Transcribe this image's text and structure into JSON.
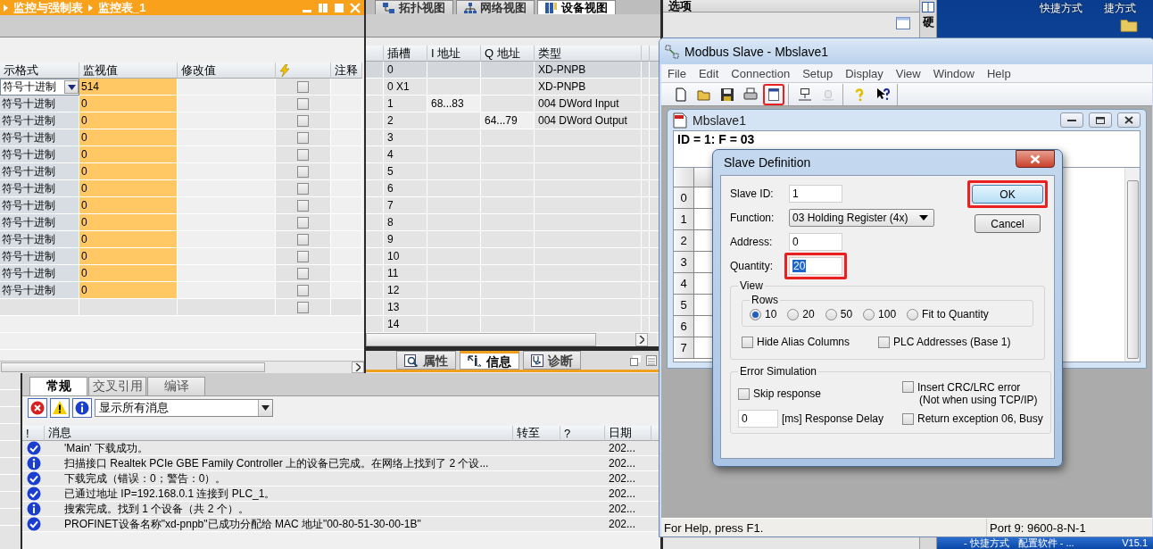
{
  "watch_table": {
    "breadcrumb": [
      "监控与强制表",
      "监控表_1"
    ],
    "columns": [
      "示格式",
      "监视值",
      "修改值",
      "注释"
    ],
    "rows": [
      {
        "format": "符号十进制",
        "value": "514",
        "editing": true,
        "checked": false
      },
      {
        "format": "符号十进制",
        "value": "0",
        "editing": false,
        "checked": false
      },
      {
        "format": "符号十进制",
        "value": "0",
        "editing": false,
        "checked": false
      },
      {
        "format": "符号十进制",
        "value": "0",
        "editing": false,
        "checked": false
      },
      {
        "format": "符号十进制",
        "value": "0",
        "editing": false,
        "checked": false
      },
      {
        "format": "符号十进制",
        "value": "0",
        "editing": false,
        "checked": false
      },
      {
        "format": "符号十进制",
        "value": "0",
        "editing": false,
        "checked": false
      },
      {
        "format": "符号十进制",
        "value": "0",
        "editing": false,
        "checked": false
      },
      {
        "format": "符号十进制",
        "value": "0",
        "editing": false,
        "checked": false
      },
      {
        "format": "符号十进制",
        "value": "0",
        "editing": false,
        "checked": false
      },
      {
        "format": "符号十进制",
        "value": "0",
        "editing": false,
        "checked": false
      },
      {
        "format": "符号十进制",
        "value": "0",
        "editing": false,
        "checked": false
      },
      {
        "format": "符号十进制",
        "value": "0",
        "editing": false,
        "checked": false
      },
      {
        "editing": false,
        "checked": false
      }
    ]
  },
  "view_tabs": [
    {
      "label": "拓扑视图",
      "selected": false
    },
    {
      "label": "网络视图",
      "selected": false
    },
    {
      "label": "设备视图",
      "selected": true
    }
  ],
  "device_table": {
    "columns": [
      "插槽",
      "I 地址",
      "Q 地址",
      "类型"
    ],
    "rows": [
      {
        "slot": "0",
        "type": "XD-PNPB",
        "selected": true
      },
      {
        "slot": "0 X1",
        "type": "XD-PNPB",
        "selected": false
      },
      {
        "slot": "1",
        "i_address": "68...83",
        "type": "004 DWord Input",
        "selected": false
      },
      {
        "slot": "2",
        "q_address": "64...79",
        "type": "004 DWord Output",
        "selected": false
      },
      {
        "slot": "3",
        "selected": false
      },
      {
        "slot": "4",
        "selected": false
      },
      {
        "slot": "5",
        "selected": false
      },
      {
        "slot": "6",
        "selected": false
      },
      {
        "slot": "7",
        "selected": false
      },
      {
        "slot": "8",
        "selected": false
      },
      {
        "slot": "9",
        "selected": false
      },
      {
        "slot": "10",
        "selected": false
      },
      {
        "slot": "11",
        "selected": false
      },
      {
        "slot": "12",
        "selected": false
      },
      {
        "slot": "13",
        "selected": false
      },
      {
        "slot": "14",
        "selected": false
      }
    ]
  },
  "inspector_tabs": [
    {
      "label": "属性",
      "selected": false
    },
    {
      "label": "信息",
      "selected": true
    },
    {
      "label": "诊断",
      "selected": false
    }
  ],
  "info_tabs": [
    {
      "label": "常规",
      "selected": true
    },
    {
      "label": "交叉引用",
      "selected": false
    },
    {
      "label": "编译",
      "selected": false
    }
  ],
  "message_filter": "显示所有消息",
  "messages": {
    "columns": [
      "!",
      "消息",
      "转至",
      "?",
      "日期"
    ],
    "rows": [
      {
        "kind": "success",
        "text": "'Main' 下载成功。",
        "date": "202..."
      },
      {
        "kind": "info",
        "text": "扫描接口 Realtek PCIe GBE Family Controller 上的设备已完成。在网络上找到了 2 个设...",
        "date": "202..."
      },
      {
        "kind": "success",
        "text": "下载完成（错误：0；警告：0）。",
        "date": "202..."
      },
      {
        "kind": "success",
        "text": "已通过地址 IP=192.168.0.1 连接到 PLC_1。",
        "date": "202..."
      },
      {
        "kind": "info",
        "text": "搜索完成。找到 1 个设备（共 2 个）。",
        "date": "202..."
      },
      {
        "kind": "success",
        "text": "PROFINET设备名称\"xd-pnpb\"已成功分配给 MAC 地址\"00-80-51-30-00-1B\"",
        "date": "202..."
      }
    ]
  },
  "options_panel": {
    "title": "选项",
    "side_tab": "硬"
  },
  "desktop": {
    "icons": [
      "快捷方式",
      "捷方式"
    ],
    "taskbar": [
      "- 快捷方式",
      "配置软件 - ...",
      "V15.1"
    ]
  },
  "modbus": {
    "title": "Modbus Slave - Mbslave1",
    "menu": [
      "File",
      "Edit",
      "Connection",
      "Setup",
      "Display",
      "View",
      "Window",
      "Help"
    ],
    "toolbar_groups": [
      {
        "buttons": [
          {
            "kind": "new",
            "disabled": false,
            "highlighted": false
          },
          {
            "kind": "open",
            "disabled": false,
            "highlighted": false
          },
          {
            "kind": "save",
            "disabled": false,
            "highlighted": false
          },
          {
            "kind": "print",
            "disabled": false,
            "highlighted": false
          },
          {
            "kind": "window",
            "disabled": false,
            "highlighted": true
          }
        ]
      },
      {
        "buttons": [
          {
            "kind": "connect",
            "disabled": false,
            "highlighted": false
          },
          {
            "kind": "disconnect",
            "disabled": true,
            "highlighted": false
          }
        ]
      },
      {
        "buttons": [
          {
            "kind": "help",
            "disabled": false,
            "highlighted": false
          },
          {
            "kind": "context_help",
            "disabled": false,
            "highlighted": false
          }
        ]
      }
    ],
    "child": {
      "title": "Mbslave1",
      "header": "ID = 1: F = 03",
      "row_numbers": [
        "0",
        "1",
        "2",
        "3",
        "4",
        "5",
        "6",
        "7"
      ]
    },
    "status": [
      "For Help, press F1.",
      "Port 9: 9600-8-N-1"
    ]
  },
  "dialog": {
    "title": "Slave Definition",
    "fields": [
      {
        "kind": "input",
        "label": "Slave ID:",
        "value": "1",
        "text_selected": false,
        "highlighted": false
      },
      {
        "kind": "select",
        "label": "Function:",
        "value": "03 Holding Register (4x)",
        "text_selected": false,
        "highlighted": false
      },
      {
        "kind": "input",
        "label": "Address:",
        "value": "0",
        "text_selected": false,
        "highlighted": false
      },
      {
        "kind": "input",
        "label": "Quantity:",
        "value": "20",
        "text_selected": true,
        "highlighted": true
      }
    ],
    "buttons": [
      {
        "label": "OK",
        "default": true,
        "highlighted": true
      },
      {
        "label": "Cancel",
        "default": false,
        "highlighted": false
      }
    ],
    "view": {
      "title": "View",
      "rows_title": "Rows",
      "rows_options": [
        {
          "label": "10",
          "selected": true
        },
        {
          "label": "20",
          "selected": false
        },
        {
          "label": "50",
          "selected": false
        },
        {
          "label": "100",
          "selected": false
        },
        {
          "label": "Fit to Quantity",
          "selected": false
        }
      ],
      "checkboxes": [
        {
          "label": "Hide Alias Columns",
          "checked": false
        },
        {
          "label": "PLC Addresses (Base 1)",
          "checked": false
        }
      ]
    },
    "error_simulation": {
      "title": "Error Simulation",
      "skip_response": {
        "label": "Skip response",
        "checked": false
      },
      "delay": {
        "value": "0",
        "label": "[ms] Response Delay"
      },
      "insert_crc": {
        "label": "Insert CRC/LRC error",
        "note": "(Not when using TCP/IP)",
        "checked": false
      },
      "return_exception": {
        "label": "Return exception 06, Busy",
        "checked": false
      }
    }
  }
}
